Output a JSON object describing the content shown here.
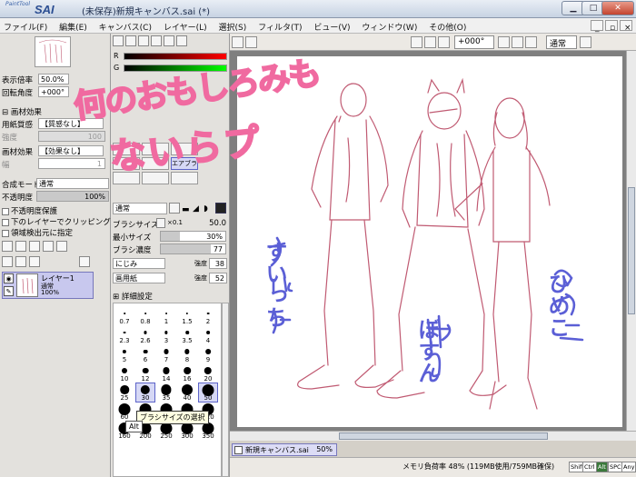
{
  "app": {
    "logo_small": "PaintTool",
    "logo_big": "SAI",
    "window_title": "(未保存)新規キャンバス.sai (*)"
  },
  "window_buttons": {
    "minimize": "▁",
    "maximize": "□",
    "close": "✕"
  },
  "menu": [
    "ファイル(F)",
    "編集(E)",
    "キャンバス(C)",
    "レイヤー(L)",
    "選択(S)",
    "フィルタ(T)",
    "ビュー(V)",
    "ウィンドウ(W)",
    "その他(O)"
  ],
  "toolbar": {
    "angle": "+000°",
    "blend_mode": "通常"
  },
  "navigator": {
    "zoom_label": "表示倍率",
    "zoom_value": "50.0%",
    "angle_label": "回転角度",
    "angle_value": "+000°"
  },
  "texture": {
    "header": "画材効果",
    "paper_label": "用紙質感",
    "paper_value": "【質感なし】",
    "paper_strength_label": "強度",
    "paper_strength_value": "100",
    "effect_label": "画材効果",
    "effect_value": "【効果なし】",
    "effect_width_label": "幅",
    "effect_width_value": "1"
  },
  "layer": {
    "blend_label": "合成モード",
    "blend_value": "通常",
    "opacity_label": "不透明度",
    "opacity_value": "100%",
    "opacity_fraction": 1.0,
    "protect_label": "不透明度保護",
    "clip_label": "下のレイヤーでクリッピング",
    "source_label": "領域検出元に指定",
    "item_name": "レイヤー1",
    "item_mode": "通常",
    "item_opacity": "100%"
  },
  "brush": {
    "mode": "通常",
    "size_label": "ブラシサイズ",
    "size_mult": "×0.1",
    "size_value": "50.0",
    "min_label": "最小サイズ",
    "min_value": "30%",
    "min_fraction": 0.3,
    "density_label": "ブラシ濃度",
    "density_value": "77",
    "density_fraction": 0.77,
    "blur_label": "にじみ",
    "blur_strength_label": "強度",
    "blur_strength": "38",
    "paper_label": "画用紙",
    "paper_strength_label": "強度",
    "paper_strength": "52",
    "detail_label": "詳細設定",
    "tool_selected": "エアブラシ",
    "sizes": [
      "0.7",
      "0.8",
      "1",
      "1.5",
      "2",
      "2.3",
      "2.6",
      "3",
      "3.5",
      "4",
      "5",
      "6",
      "7",
      "8",
      "9",
      "10",
      "12",
      "14",
      "16",
      "20",
      "25",
      "30",
      "35",
      "40",
      "50",
      "60",
      "70",
      "80",
      "100",
      "120",
      "160",
      "200",
      "250",
      "300",
      "350"
    ],
    "selected_sizes": [
      "30",
      "50"
    ],
    "tooltip": "ブラシサイズの選択",
    "alt_label": "Alt"
  },
  "document_tab": {
    "name": "新規キャンバス.sai",
    "zoom": "50%"
  },
  "status": {
    "memory": "メモリ負荷率 48% (119MB使用/759MB確保)",
    "badges": [
      "Shift",
      "Ctrl",
      "Alt",
      "SPC",
      "Any"
    ]
  },
  "canvas_text": {
    "line1": "何のおもしろみも",
    "line2": "ないらプ",
    "left_name": "すいっち",
    "center_name": "ぼすん",
    "right_name": "ひめこ"
  },
  "colors": {
    "sketch": "#c05a72",
    "overlay_text": "#f06aa0",
    "names": "#5b5fd6",
    "layer_selected": "#c8c8ee"
  }
}
